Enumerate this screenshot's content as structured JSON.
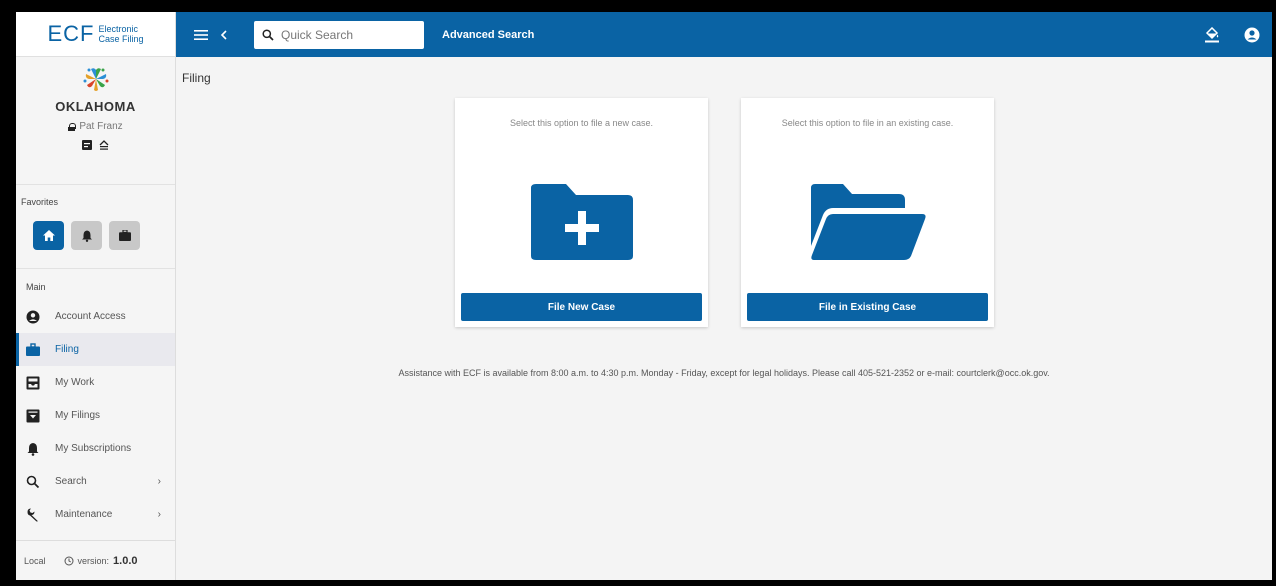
{
  "app": {
    "logo_main": "ECF",
    "logo_sub_line1": "Electronic",
    "logo_sub_line2": "Case Filing",
    "state_name": "OKLAHOMA",
    "user_name": "Pat Franz"
  },
  "topbar": {
    "search_placeholder": "Quick Search",
    "advanced_search_label": "Advanced Search"
  },
  "sidebar": {
    "favorites_label": "Favorites",
    "main_label": "Main",
    "items": [
      {
        "label": "Account Access",
        "icon": "user-circle-icon",
        "active": false
      },
      {
        "label": "Filing",
        "icon": "briefcase-icon",
        "active": true
      },
      {
        "label": "My Work",
        "icon": "inbox-icon",
        "active": false
      },
      {
        "label": "My Filings",
        "icon": "archive-icon",
        "active": false
      },
      {
        "label": "My Subscriptions",
        "icon": "bell-icon",
        "active": false
      },
      {
        "label": "Search",
        "icon": "search-icon",
        "active": false,
        "chevron": "›"
      },
      {
        "label": "Maintenance",
        "icon": "wrench-icon",
        "active": false,
        "chevron": "›"
      }
    ],
    "footer_env": "Local",
    "footer_version_label": "version:",
    "footer_version": "1.0.0"
  },
  "content": {
    "page_title": "Filing",
    "new_case": {
      "description": "Select this option to file a new case.",
      "button_label": "File New Case"
    },
    "existing_case": {
      "description": "Select this option to file in an existing case.",
      "button_label": "File in Existing Case"
    },
    "assistance_text": "Assistance with ECF is available from 8:00 a.m. to 4:30 p.m. Monday - Friday, except for legal holidays. Please call 405-521-2352 or e-mail: courtclerk@occ.ok.gov."
  },
  "colors": {
    "primary": "#0a63a4",
    "sidebar_bg": "#f5f5f5",
    "content_bg": "#f4f4f4"
  }
}
